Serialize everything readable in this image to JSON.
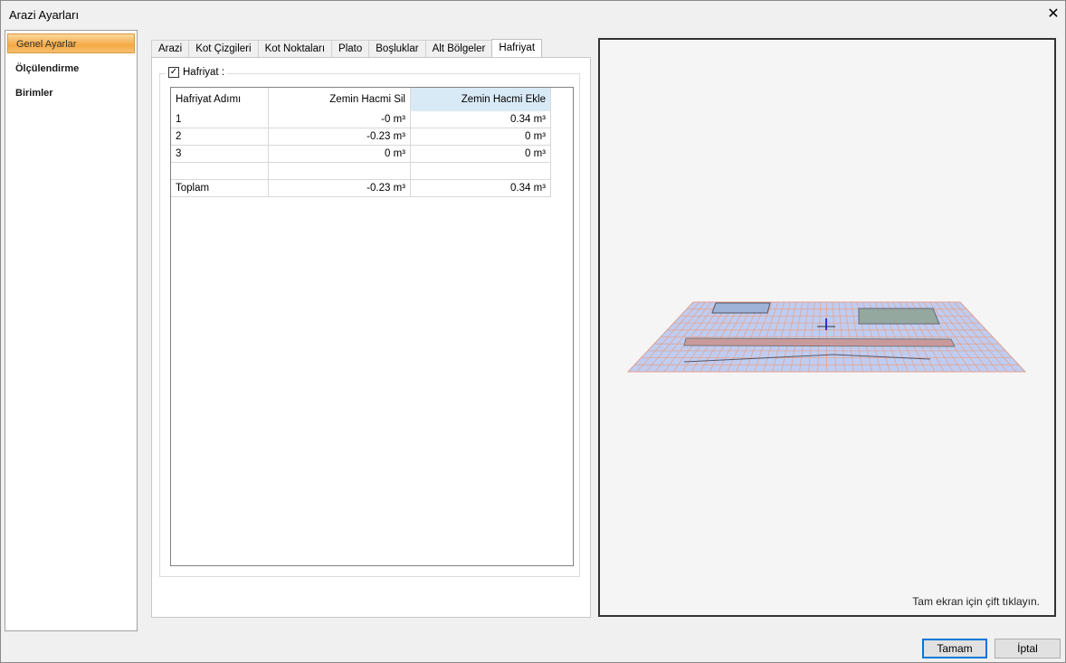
{
  "window": {
    "title": "Arazi Ayarları",
    "close": "✕"
  },
  "sidebar": {
    "items": [
      {
        "label": "Genel Ayarlar"
      },
      {
        "label": "Ölçülendirme"
      },
      {
        "label": "Birimler"
      }
    ]
  },
  "tabs": [
    "Arazi",
    "Kot Çizgileri",
    "Kot Noktaları",
    "Plato",
    "Boşluklar",
    "Alt Bölgeler",
    "Hafriyat"
  ],
  "group": {
    "label": "Hafriyat :",
    "checked": "✓"
  },
  "table": {
    "headers": [
      "Hafriyat Adımı",
      "Zemin Hacmi Sil",
      "Zemin Hacmi Ekle"
    ],
    "rows": [
      [
        "1",
        "-0 m³",
        "0.34 m³"
      ],
      [
        "2",
        "-0.23 m³",
        "0 m³"
      ],
      [
        "3",
        "0 m³",
        "0 m³"
      ],
      [
        "",
        "",
        ""
      ],
      [
        "Toplam",
        "-0.23 m³",
        "0.34 m³"
      ]
    ]
  },
  "preview": {
    "hint": "Tam ekran için çift tıklayın."
  },
  "buttons": {
    "ok": "Tamam",
    "cancel": "İptal"
  }
}
